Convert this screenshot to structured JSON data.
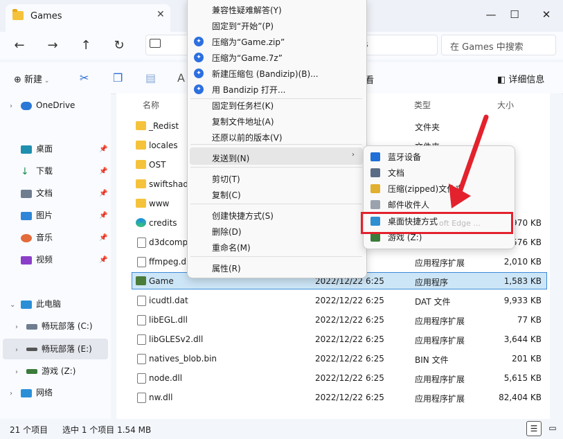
{
  "window": {
    "tab_title": "Games",
    "tab_close": "✕",
    "controls": {
      "minimize": "—",
      "maximize": "☐",
      "close": "✕"
    }
  },
  "nav": {
    "back": "←",
    "forward": "→",
    "up": "↑",
    "refresh": "↻",
    "address_tail": "es",
    "search_placeholder": "在 Games 中搜索"
  },
  "toolbar": {
    "new_label": "新建",
    "view_label": "看",
    "details_label": "详细信息"
  },
  "sidebar": {
    "items": [
      {
        "label": "OneDrive",
        "chev": "›"
      },
      {
        "label": "桌面"
      },
      {
        "label": "下载"
      },
      {
        "label": "文档"
      },
      {
        "label": "图片"
      },
      {
        "label": "音乐"
      },
      {
        "label": "视频"
      },
      {
        "label": "此电脑",
        "chev": "⌄"
      },
      {
        "label": "畅玩部落 (C:)",
        "chev": "›"
      },
      {
        "label": "畅玩部落 (E:)",
        "chev": "›"
      },
      {
        "label": "游戏 (Z:)",
        "chev": "›"
      },
      {
        "label": "网络",
        "chev": "›"
      }
    ],
    "pin": "📌"
  },
  "columns": {
    "name": "名称",
    "type": "类型",
    "size": "大小"
  },
  "files": [
    {
      "name": "_Redist",
      "date": "20",
      "type": "文件夹",
      "size": "",
      "kind": "folder"
    },
    {
      "name": "locales",
      "date": "20",
      "type": "文件夹",
      "size": "",
      "kind": "folder"
    },
    {
      "name": "OST",
      "date": "",
      "type": "",
      "size": "",
      "kind": "folder"
    },
    {
      "name": "swiftshad",
      "date": "",
      "type": "",
      "size": "",
      "kind": "folder"
    },
    {
      "name": "www",
      "date": "",
      "type": "",
      "size": "",
      "kind": "folder"
    },
    {
      "name": "credits",
      "date": "",
      "type": "",
      "size": "970 KB",
      "kind": "edge"
    },
    {
      "name": "d3dcomp",
      "date": "",
      "type": "",
      "size": "3,576 KB",
      "kind": "doc"
    },
    {
      "name": "ffmpeg.d",
      "date": "6:25",
      "type": "应用程序扩展",
      "size": "2,010 KB",
      "kind": "doc"
    },
    {
      "name": "Game",
      "date": "2022/12/22 6:25",
      "type": "应用程序",
      "size": "1,583 KB",
      "kind": "game"
    },
    {
      "name": "icudtl.dat",
      "date": "2022/12/22 6:25",
      "type": "DAT 文件",
      "size": "9,933 KB",
      "kind": "doc"
    },
    {
      "name": "libEGL.dll",
      "date": "2022/12/22 6:25",
      "type": "应用程序扩展",
      "size": "77 KB",
      "kind": "doc"
    },
    {
      "name": "libGLESv2.dll",
      "date": "2022/12/22 6:25",
      "type": "应用程序扩展",
      "size": "3,644 KB",
      "kind": "doc"
    },
    {
      "name": "natives_blob.bin",
      "date": "2022/12/22 6:25",
      "type": "BIN 文件",
      "size": "201 KB",
      "kind": "doc"
    },
    {
      "name": "node.dll",
      "date": "2022/12/22 6:25",
      "type": "应用程序扩展",
      "size": "5,615 KB",
      "kind": "doc"
    },
    {
      "name": "nw.dll",
      "date": "2022/12/22 6:25",
      "type": "应用程序扩展",
      "size": "82,404 KB",
      "kind": "doc"
    }
  ],
  "status": {
    "count": "21 个项目",
    "selected": "选中 1 个项目  1.54 MB"
  },
  "context_menu": {
    "items": [
      {
        "label": "兼容性疑难解答(Y)"
      },
      {
        "label": "固定到“开始”(P)"
      },
      {
        "label": "压缩为“Game.zip”",
        "icon": true
      },
      {
        "label": "压缩为“Game.7z”",
        "icon": true
      },
      {
        "label": "新建压缩包 (Bandizip)(B)...",
        "icon": true
      },
      {
        "label": "用 Bandizip 打开...",
        "icon": true
      },
      {
        "label": "固定到任务栏(K)"
      },
      {
        "label": "复制文件地址(A)"
      },
      {
        "label": "还原以前的版本(V)"
      },
      {
        "label": "发送到(N)"
      },
      {
        "label": "剪切(T)"
      },
      {
        "label": "复制(C)"
      },
      {
        "label": "创建快捷方式(S)"
      },
      {
        "label": "删除(D)"
      },
      {
        "label": "重命名(M)"
      },
      {
        "label": "属性(R)"
      }
    ],
    "submenu_arrow": "›"
  },
  "sendto_menu": {
    "items": [
      {
        "label": "蓝牙设备",
        "color": "#1f6fd6"
      },
      {
        "label": "文档",
        "color": "#5b6d86"
      },
      {
        "label": "压缩(zipped)文件夹",
        "color": "#e2b030"
      },
      {
        "label": "邮件收件人",
        "color": "#9aa3ad"
      },
      {
        "label": "桌面快捷方式",
        "color": "#2f8fd0"
      },
      {
        "label": "游戏 (Z:)",
        "color": "#3b7b3b"
      }
    ],
    "ghost_text": "oft Edge ..."
  },
  "highlight_color": "#e3222d"
}
